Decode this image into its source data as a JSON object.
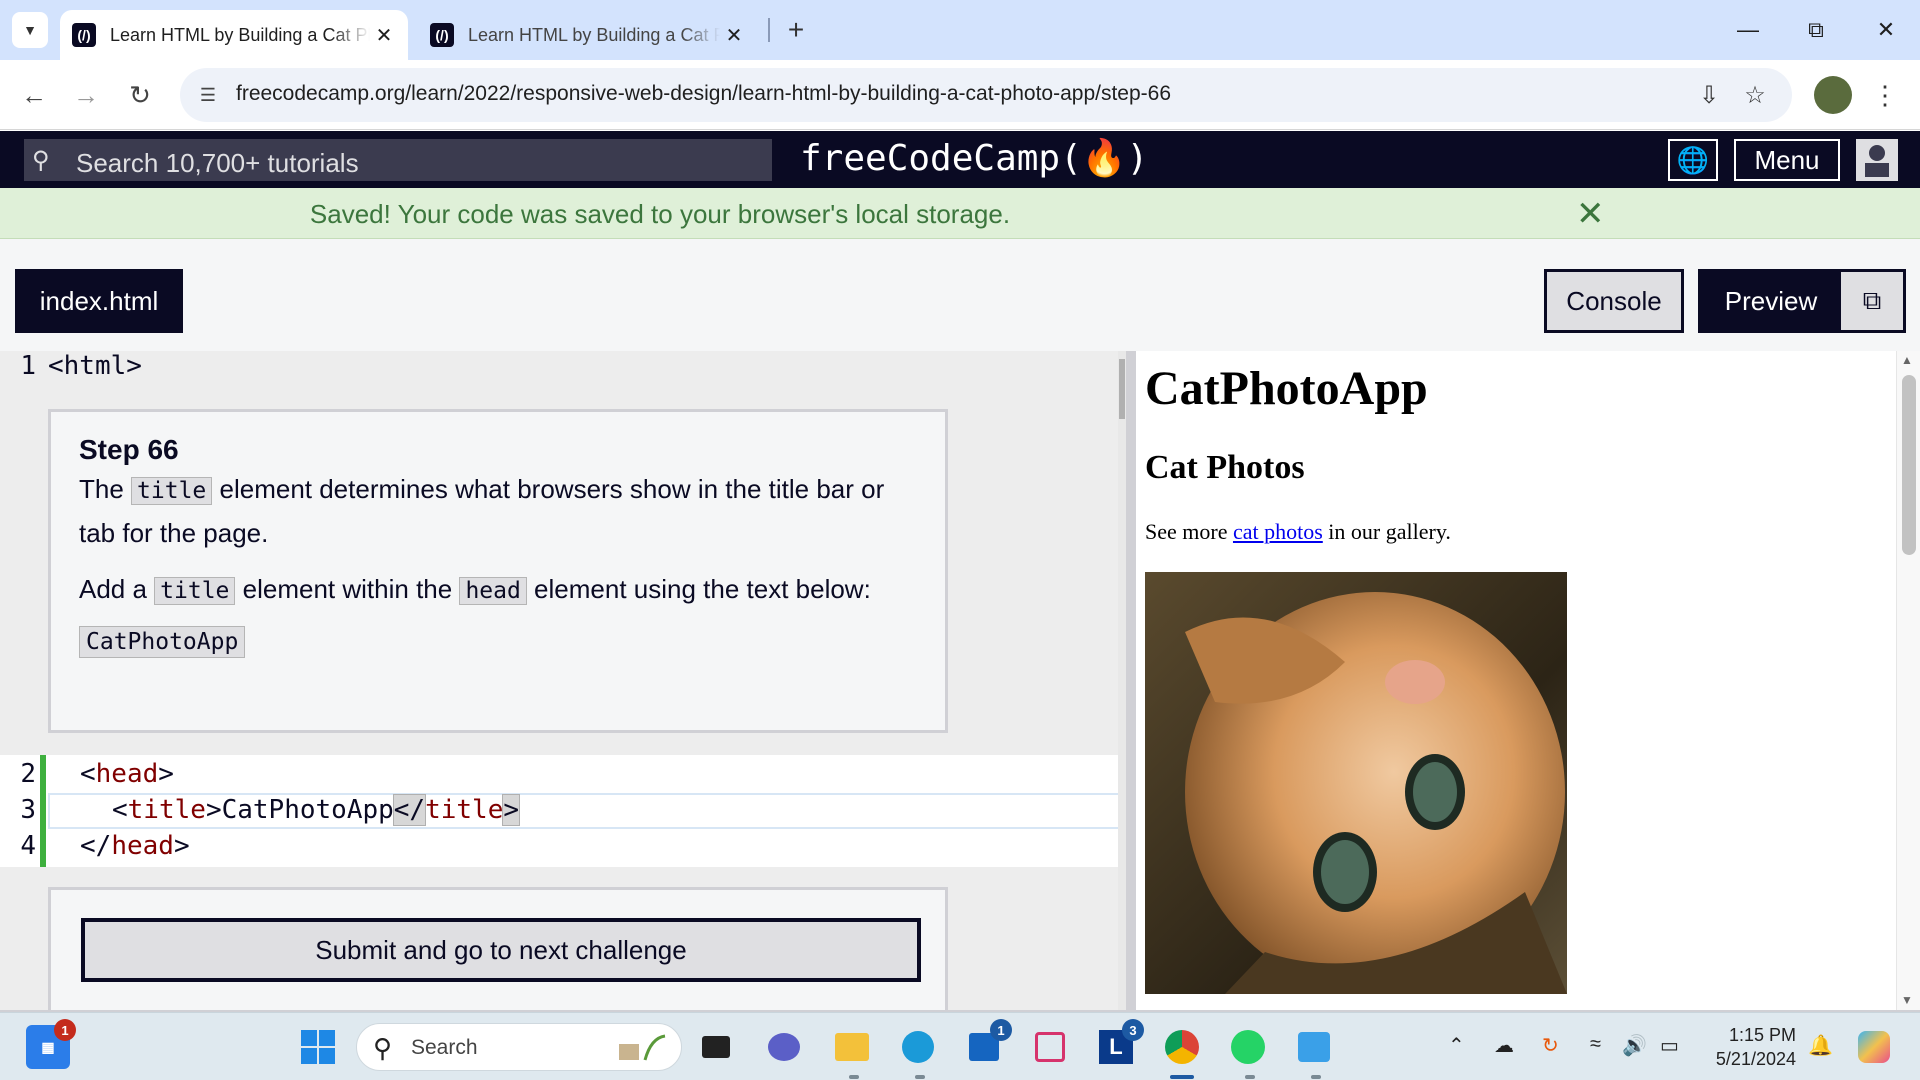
{
  "browser": {
    "tabs": [
      {
        "title": "Learn HTML by Building a Cat Photo App",
        "active": true
      },
      {
        "title": "Learn HTML by Building a Cat Photo App",
        "active": false
      }
    ],
    "url": "freecodecamp.org/learn/2022/responsive-web-design/learn-html-by-building-a-cat-photo-app/step-66"
  },
  "fcc_nav": {
    "search_placeholder": "Search 10,700+ tutorials",
    "logo": "freeCodeCamp(🔥)",
    "menu_label": "Menu"
  },
  "flash": {
    "message": "Saved! Your code was saved to your browser's local storage."
  },
  "toolbar": {
    "file_tab": "index.html",
    "console_label": "Console",
    "preview_label": "Preview"
  },
  "editor": {
    "line_numbers": [
      "1",
      "2",
      "3",
      "4"
    ],
    "line1": "<html>",
    "line2_open": "<",
    "line2_tag": "head",
    "line2_close": ">",
    "line3_open": "<",
    "line3_tag": "title",
    "line3_close": ">",
    "line3_text": "CatPhotoApp",
    "line3_endopen": "</",
    "line3_endtag": "title",
    "line3_endclose": ">",
    "line4_open": "</",
    "line4_tag": "head",
    "line4_close": ">",
    "step": {
      "heading": "Step 66",
      "p1_a": "The ",
      "p1_code": "title",
      "p1_b": " element determines what browsers show in the title bar or tab for the page.",
      "p2_a": "Add a ",
      "p2_code1": "title",
      "p2_b": " element within the ",
      "p2_code2": "head",
      "p2_c": " element using the text below:",
      "code_block": "CatPhotoApp"
    },
    "submit_label": "Submit and go to next challenge"
  },
  "preview": {
    "h1": "CatPhotoApp",
    "h2": "Cat Photos",
    "text_before": "See more ",
    "link": "cat photos",
    "text_after": " in our gallery."
  },
  "taskbar": {
    "search_label": "Search",
    "time": "1:15 PM",
    "date": "5/21/2024",
    "badges": {
      "widgets": "1",
      "store": "1",
      "app_l": "3"
    }
  },
  "colors": {
    "fcc_navy": "#0a0a23",
    "flash_bg": "#dff0d8",
    "flash_text": "#3c763d",
    "tag_color": "#800000",
    "edit_marker": "#3eb03e",
    "link_blue": "#0000ee"
  }
}
